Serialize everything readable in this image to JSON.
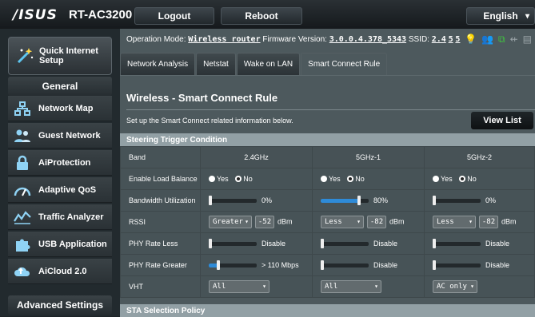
{
  "header": {
    "logo": "/ISUS",
    "model": "RT-AC3200",
    "logout_label": "Logout",
    "reboot_label": "Reboot",
    "language": "English"
  },
  "sidebar": {
    "quick_setup_label": "Quick Internet Setup",
    "general_title": "General",
    "items": [
      {
        "label": "Network Map",
        "icon": "network-map-icon"
      },
      {
        "label": "Guest Network",
        "icon": "guest-network-icon"
      },
      {
        "label": "AiProtection",
        "icon": "lock-icon"
      },
      {
        "label": "Adaptive QoS",
        "icon": "gauge-icon"
      },
      {
        "label": "Traffic Analyzer",
        "icon": "chart-icon"
      },
      {
        "label": "USB Application",
        "icon": "puzzle-icon"
      },
      {
        "label": "AiCloud 2.0",
        "icon": "cloud-icon"
      }
    ],
    "advanced_title": "Advanced Settings"
  },
  "status": {
    "op_mode_label": "Operation Mode:",
    "op_mode_value": "Wireless router",
    "fw_label": "Firmware Version:",
    "fw_value": "3.0.0.4.378_5343",
    "ssid_label": "SSID:",
    "ssid_values": [
      "2.4",
      "5",
      "5"
    ]
  },
  "tabs": [
    {
      "label": "Network Analysis",
      "active": false
    },
    {
      "label": "Netstat",
      "active": false
    },
    {
      "label": "Wake on LAN",
      "active": false
    },
    {
      "label": "Smart Connect Rule",
      "active": true
    }
  ],
  "content": {
    "title": "Wireless - Smart Connect Rule",
    "description": "Set up the Smart Connect related information below.",
    "view_list_label": "View List",
    "steering_header": "Steering Trigger Condition",
    "sta_header": "STA Selection Policy"
  },
  "table": {
    "band_label": "Band",
    "bands": [
      "2.4GHz",
      "5GHz-1",
      "5GHz-2"
    ],
    "load_balance": {
      "label": "Enable Load Balance",
      "yes": "Yes",
      "no": "No",
      "values": [
        "No",
        "No",
        "No"
      ]
    },
    "bandwidth": {
      "label": "Bandwidth Utilization",
      "values": [
        {
          "text": "0%",
          "fraction": 0.0
        },
        {
          "text": "80%",
          "fraction": 0.8
        },
        {
          "text": "0%",
          "fraction": 0.0
        }
      ]
    },
    "rssi": {
      "label": "RSSI",
      "unit": "dBm",
      "values": [
        {
          "cmp": "Greater",
          "num": "-52"
        },
        {
          "cmp": "Less",
          "num": "-82"
        },
        {
          "cmp": "Less",
          "num": "-82"
        }
      ]
    },
    "phy_less": {
      "label": "PHY Rate Less",
      "values": [
        "Disable",
        "Disable",
        "Disable"
      ],
      "fractions": [
        0.0,
        0.0,
        0.0
      ]
    },
    "phy_greater": {
      "label": "PHY Rate Greater",
      "values": [
        "> 110 Mbps",
        "Disable",
        "Disable"
      ],
      "fractions": [
        0.2,
        0.0,
        0.0
      ]
    },
    "vht": {
      "label": "VHT",
      "values": [
        "All",
        "All",
        "AC only"
      ]
    }
  },
  "colors": {
    "accent": "#2e8bd8",
    "status_yellow": "#e8d21c",
    "status_green": "#3fc43f"
  }
}
